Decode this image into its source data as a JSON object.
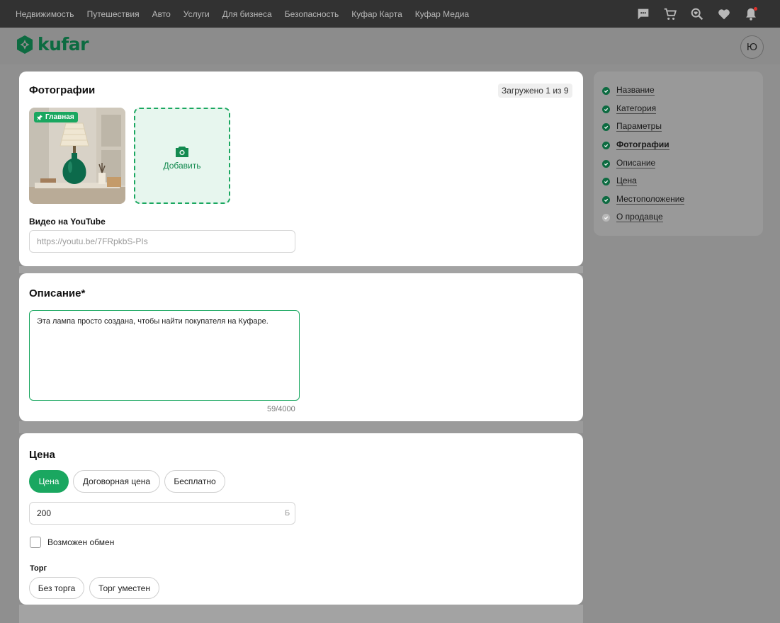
{
  "topnav": [
    "Недвижимость",
    "Путешествия",
    "Авто",
    "Услуги",
    "Для бизнеса",
    "Безопасность",
    "Куфар Карта",
    "Куфар Медиа"
  ],
  "logo": {
    "text": "kufar",
    "color": "#0d6b41"
  },
  "avatar": {
    "initial": "Ю"
  },
  "photos": {
    "title": "Фотографии",
    "uploaded": "Загружено 1 из 9",
    "main_badge": "Главная",
    "add_label": "Добавить",
    "youtube_label": "Видео на YouTube",
    "youtube_placeholder": "https://youtu.be/7FRpkbS-PIs"
  },
  "description": {
    "title": "Описание*",
    "value": "Эта лампа просто создана, чтобы найти покупателя на Куфаре.",
    "counter": "59/4000"
  },
  "price": {
    "title": "Цена",
    "options": [
      "Цена",
      "Договорная цена",
      "Бесплатно"
    ],
    "active_option": "Цена",
    "value": "200",
    "currency": "Б",
    "exchange_label": "Возможен обмен",
    "exchange_checked": false,
    "bargain_label": "Торг",
    "bargain_options": [
      "Без торга",
      "Торг уместен"
    ]
  },
  "sidebar": {
    "items": [
      {
        "label": "Название",
        "done": true,
        "current": false
      },
      {
        "label": "Категория",
        "done": true,
        "current": false
      },
      {
        "label": "Параметры",
        "done": true,
        "current": false
      },
      {
        "label": "Фотографии",
        "done": true,
        "current": true
      },
      {
        "label": "Описание",
        "done": true,
        "current": false
      },
      {
        "label": "Цена",
        "done": true,
        "current": false
      },
      {
        "label": "Местоположение",
        "done": true,
        "current": false
      },
      {
        "label": "О продавце",
        "done": false,
        "current": false
      }
    ]
  },
  "colors": {
    "accent": "#1aa760",
    "brand": "#0d6b41",
    "topbar": "#323232"
  },
  "icons": [
    "chat-icon",
    "cart-icon",
    "search-heart-icon",
    "heart-icon",
    "bell-icon",
    "camera-icon",
    "pin-icon",
    "check-icon"
  ]
}
